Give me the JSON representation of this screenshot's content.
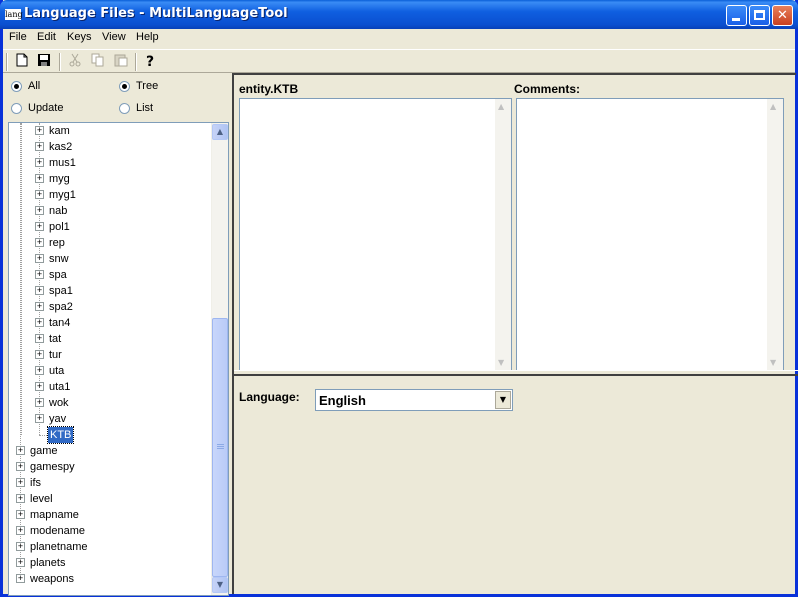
{
  "window": {
    "icon_text": "lang",
    "title": "Language Files - MultiLanguageTool",
    "minimize": "minimize",
    "maximize": "maximize",
    "close": "✕"
  },
  "menu": [
    "File",
    "Edit",
    "Keys",
    "View",
    "Help"
  ],
  "toolbar": {
    "icons": [
      "new-file-icon",
      "save-icon",
      "cut-icon",
      "copy-icon",
      "paste-icon",
      "help-icon"
    ]
  },
  "filters": {
    "all": {
      "label": "All",
      "checked": true
    },
    "update": {
      "label": "Update",
      "checked": false
    },
    "tree": {
      "label": "Tree",
      "checked": true
    },
    "list": {
      "label": "List",
      "checked": false
    }
  },
  "tree": {
    "children": [
      "kam",
      "kas2",
      "mus1",
      "myg",
      "myg1",
      "nab",
      "pol1",
      "rep",
      "snw",
      "spa",
      "spa1",
      "spa2",
      "tan4",
      "tat",
      "tur",
      "uta",
      "uta1",
      "wok",
      "yav"
    ],
    "selected": "KTB",
    "roots": [
      "game",
      "gamespy",
      "ifs",
      "level",
      "mapname",
      "modename",
      "planetname",
      "planets",
      "weapons"
    ]
  },
  "editor": {
    "file_label": "entity.KTB",
    "comments_label": "Comments:",
    "file_text": "",
    "comments_text": ""
  },
  "language": {
    "label": "Language:",
    "value": "English"
  }
}
